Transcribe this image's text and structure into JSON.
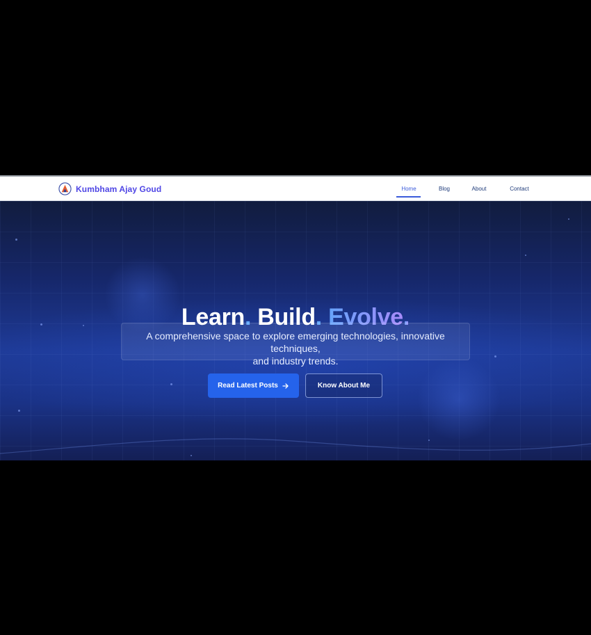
{
  "brand": {
    "name": "Kumbham Ajay Goud",
    "logo_icon": "triangle-logo-icon"
  },
  "nav": {
    "items": [
      {
        "label": "Home",
        "active": true
      },
      {
        "label": "Blog",
        "active": false
      },
      {
        "label": "About",
        "active": false
      },
      {
        "label": "Contact",
        "active": false
      }
    ]
  },
  "hero": {
    "title_parts": [
      "Learn",
      ".",
      " Build",
      ".",
      " Evolve",
      "."
    ],
    "subtitle_line1": "A comprehensive space to explore emerging technologies, innovative techniques,",
    "subtitle_line2": "and industry trends.",
    "primary_button": "Read Latest Posts",
    "primary_button_icon": "arrow-right-icon",
    "secondary_button": "Know About Me"
  },
  "colors": {
    "brand": "#4f46e5",
    "primary_button": "#2563eb",
    "hero_dark": "#111c3e",
    "hero_mid": "#1e3a96",
    "accent_gradient_start": "#60a5fa",
    "accent_gradient_end": "#a78bfa"
  }
}
